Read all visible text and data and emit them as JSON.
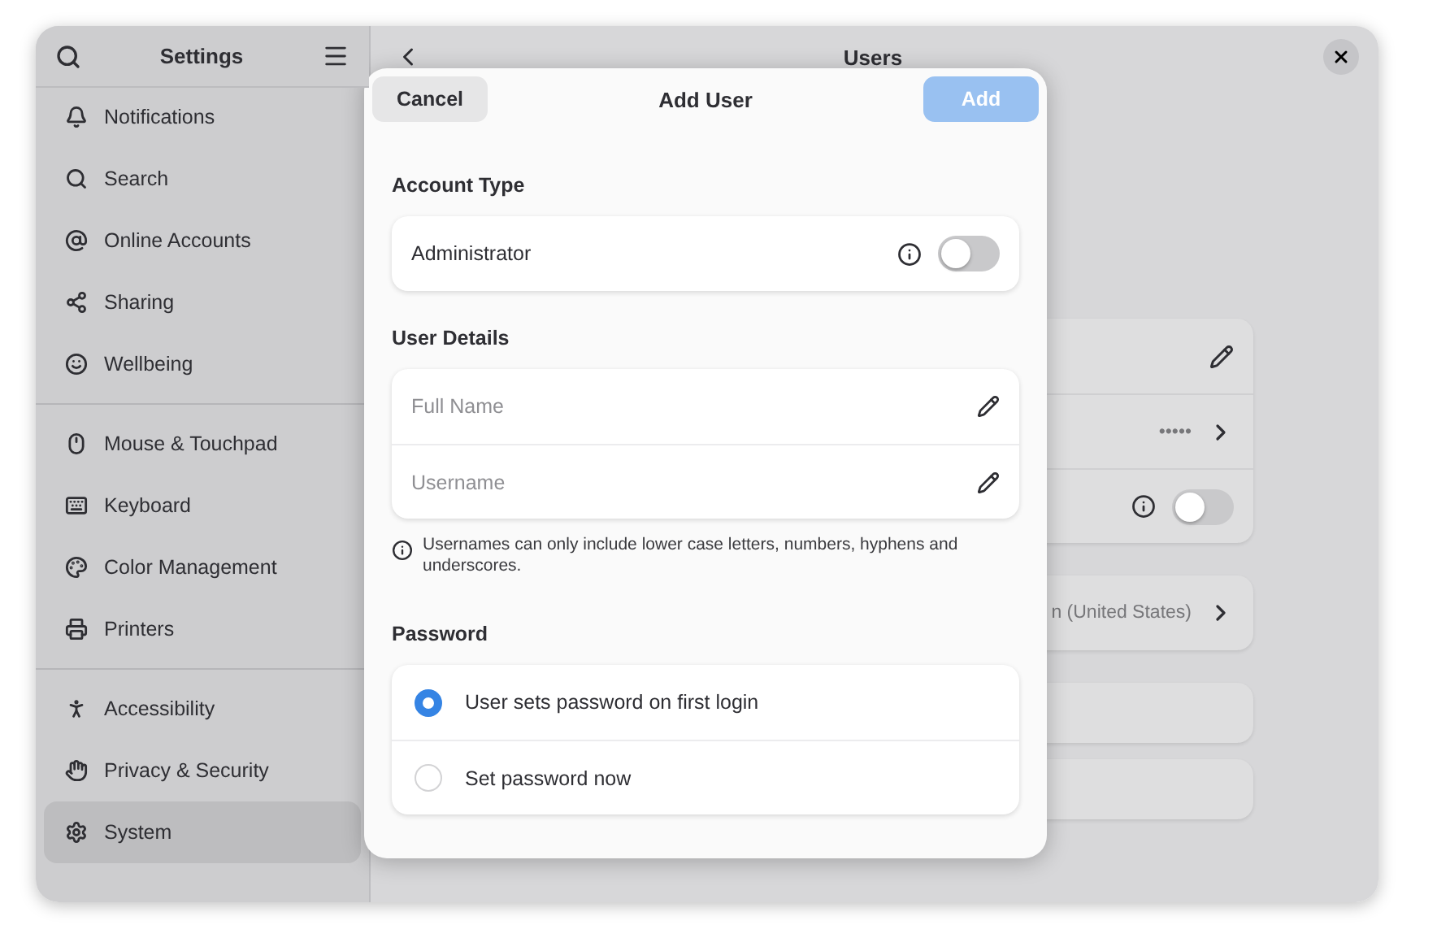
{
  "sidebar": {
    "title": "Settings",
    "groups": [
      {
        "items": [
          {
            "label": "Notifications",
            "selected": false
          },
          {
            "label": "Search",
            "selected": false
          },
          {
            "label": "Online Accounts",
            "selected": false
          },
          {
            "label": "Sharing",
            "selected": false
          },
          {
            "label": "Wellbeing",
            "selected": false
          }
        ]
      },
      {
        "items": [
          {
            "label": "Mouse & Touchpad",
            "selected": false
          },
          {
            "label": "Keyboard",
            "selected": false
          },
          {
            "label": "Color Management",
            "selected": false
          },
          {
            "label": "Printers",
            "selected": false
          }
        ]
      },
      {
        "items": [
          {
            "label": "Accessibility",
            "selected": false
          },
          {
            "label": "Privacy & Security",
            "selected": false
          },
          {
            "label": "System",
            "selected": true
          }
        ]
      }
    ]
  },
  "page": {
    "title": "Users",
    "cards": [
      {
        "rows": [
          {
            "kind": "edit"
          },
          {
            "kind": "value",
            "value": "•••••"
          },
          {
            "kind": "toggle",
            "on": false
          }
        ]
      },
      {
        "rows": [
          {
            "kind": "value",
            "value": "n (United States)"
          }
        ]
      },
      {
        "rows": [
          {
            "kind": "blank"
          }
        ]
      },
      {
        "rows": [
          {
            "kind": "blank"
          }
        ]
      }
    ]
  },
  "dialog": {
    "title": "Add User",
    "cancel": "Cancel",
    "confirm": {
      "label": "Add",
      "disabled": true
    },
    "account_type": {
      "heading": "Account Type",
      "label": "Administrator",
      "on": false
    },
    "user_details": {
      "heading": "User Details",
      "fields": [
        {
          "placeholder": "Full Name"
        },
        {
          "placeholder": "Username"
        }
      ],
      "note": "Usernames can only include lower case letters, numbers, hyphens and underscores."
    },
    "password": {
      "heading": "Password",
      "options": [
        {
          "label": "User sets password on first login",
          "selected": true
        },
        {
          "label": "Set password now",
          "selected": false
        }
      ]
    }
  }
}
